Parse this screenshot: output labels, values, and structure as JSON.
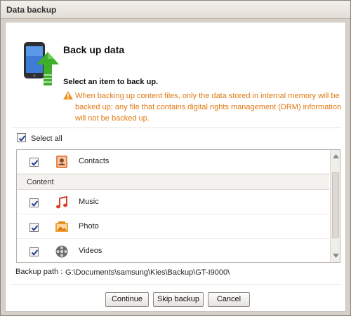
{
  "window": {
    "title": "Data backup"
  },
  "header": {
    "title": "Back up data",
    "subtitle": "Select an item to back up.",
    "warning": "When backing up content files, only the data stored in internal memory will be backed up; any file that contains digital rights management (DRM) information will not be backed up.",
    "warning_icon": "warning-icon",
    "hero_icon": "phone-backup-icon"
  },
  "select_all": {
    "label": "Select all",
    "checked": true
  },
  "list": {
    "items": [
      {
        "label": "Contacts",
        "checked": true,
        "icon": "contacts-icon"
      }
    ],
    "section": {
      "label": "Content"
    },
    "content_items": [
      {
        "label": "Music",
        "checked": true,
        "icon": "music-icon"
      },
      {
        "label": "Photo",
        "checked": true,
        "icon": "photo-icon"
      },
      {
        "label": "Videos",
        "checked": true,
        "icon": "videos-icon"
      }
    ]
  },
  "backup_path": {
    "label": "Backup path :",
    "value": "G:\\Documents\\samsung\\Kies\\Backup\\GT-I9000\\"
  },
  "buttons": {
    "continue": "Continue",
    "skip": "Skip backup",
    "cancel": "Cancel"
  },
  "colors": {
    "warning_text": "#e07a12",
    "arrow_green": "#3fae2a",
    "checkmark": "#1f3f8f"
  }
}
